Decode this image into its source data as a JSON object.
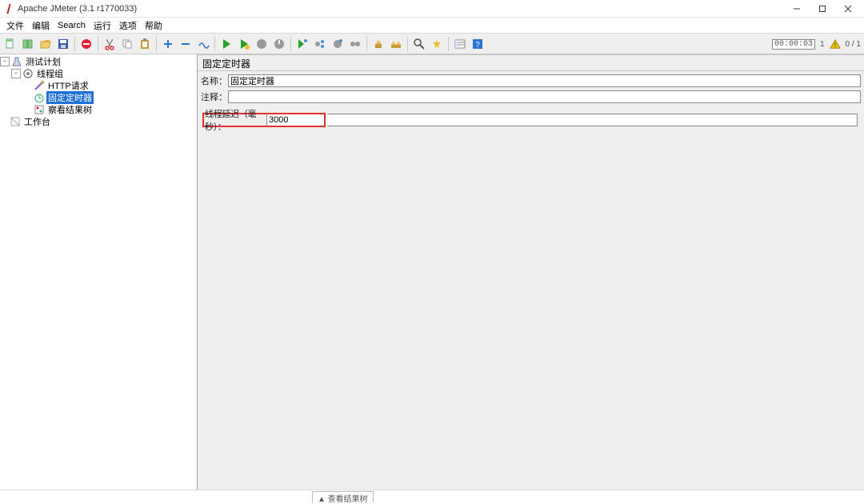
{
  "window": {
    "title": "Apache JMeter (3.1 r1770033)",
    "controls": {
      "min": "—",
      "max": "▢",
      "close": "✕"
    }
  },
  "menu": {
    "file": "文件",
    "edit": "编辑",
    "search": "Search",
    "run": "运行",
    "options": "选项",
    "help": "帮助"
  },
  "toolbar_status": {
    "timer": "00:00:03",
    "warn_count": "1",
    "threads": "0 / 1"
  },
  "tree": {
    "plan": "测试计划",
    "thread_group": "线程组",
    "http": "HTTP请求",
    "timer": "固定定时器",
    "listener": "察看结果树",
    "workbench": "工作台"
  },
  "editor": {
    "title": "固定定时器",
    "name_label": "名称：",
    "name_value": "固定定时器",
    "comment_label": "注释：",
    "comment_value": "",
    "delay_label": "线程延迟（毫秒）：",
    "delay_value": "3000"
  },
  "footer": {
    "tab": "▲ 查看结果树"
  }
}
